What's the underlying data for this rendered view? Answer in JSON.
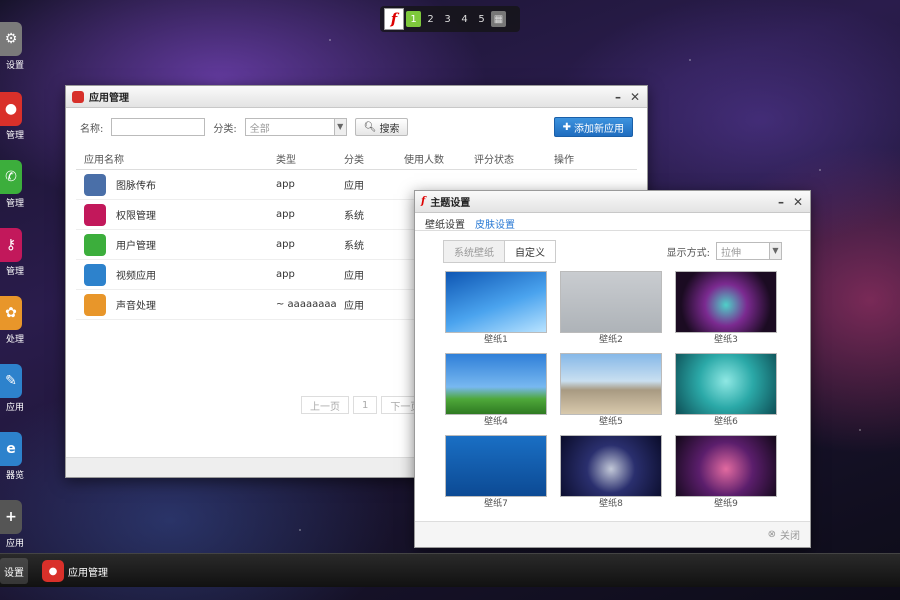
{
  "topbar": {
    "workspaces": [
      "1",
      "2",
      "3",
      "4",
      "5"
    ],
    "active_workspace": "1",
    "flash_glyph": "f"
  },
  "dock": {
    "items": [
      {
        "label": "设置",
        "color": "#7a7a7a"
      },
      {
        "label": "管理",
        "color": "#d9302a"
      },
      {
        "label": "管理",
        "color": "#3cae3c"
      },
      {
        "label": "管理",
        "color": "#c2185b"
      },
      {
        "label": "处理",
        "color": "#e8962a"
      },
      {
        "label": "应用",
        "color": "#2d82cc"
      },
      {
        "label": "器览",
        "color": "#2d82cc"
      },
      {
        "label": "应用",
        "color": "#555555"
      }
    ]
  },
  "taskbar": {
    "items": [
      {
        "label": "设置",
        "active": true
      },
      {
        "label": "应用管理",
        "active": false
      }
    ]
  },
  "app_manager": {
    "title": "应用管理",
    "filters": {
      "name_label": "名称:",
      "category_label": "分类:",
      "category_value": "全部",
      "search_button": "搜索",
      "add_button": "添加新应用"
    },
    "columns": [
      "应用名称",
      "类型",
      "分类",
      "使用人数",
      "评分状态",
      "操作"
    ],
    "rows": [
      {
        "name": "图脉传布",
        "type": "app",
        "category": "应用",
        "icon_color": "#4a6fa8"
      },
      {
        "name": "权限管理",
        "type": "app",
        "category": "系统",
        "icon_color": "#c2185b"
      },
      {
        "name": "用户管理",
        "type": "app",
        "category": "系统",
        "icon_color": "#3cae3c"
      },
      {
        "name": "视频应用",
        "type": "app",
        "category": "应用",
        "icon_color": "#2d82cc"
      },
      {
        "name": "声音处理",
        "type": "~ aaaaaaaa",
        "category": "应用",
        "icon_color": "#e8962a"
      }
    ],
    "pager": {
      "prev": "上一页",
      "page": "1",
      "next": "下一页"
    }
  },
  "theme_settings": {
    "title": "主题设置",
    "tabs": [
      "壁纸设置",
      "皮肤设置"
    ],
    "active_tab": "皮肤设置",
    "segment": [
      "系统壁纸",
      "自定义"
    ],
    "display_mode_label": "显示方式:",
    "display_mode_value": "拉伸",
    "wallpapers": [
      {
        "caption": "壁纸1",
        "bg": "linear-gradient(160deg,#0e56b3,#4aa3ee 55%,#b9e3ff)"
      },
      {
        "caption": "壁纸2",
        "bg": "linear-gradient(180deg,#c9ccd0,#aeb3b8)"
      },
      {
        "caption": "壁纸3",
        "bg": "radial-gradient(circle at 50% 55%,#4fd0c8 0%,#7b2a90 35%,#1b0b22 75%)"
      },
      {
        "caption": "壁纸4",
        "bg": "linear-gradient(180deg,#2f7fd8 0%,#78b8f0 55%,#4ea83a 75%,#2f7a22 100%)"
      },
      {
        "caption": "壁纸5",
        "bg": "linear-gradient(180deg,#86b8e8 0%,#c9dff0 45%,#a89a82 60%,#d8c9ac 100%)"
      },
      {
        "caption": "壁纸6",
        "bg": "radial-gradient(circle at 50% 45%,#8fe8e4 0%,#2ba9a8 45%,#0d4f56 100%)"
      },
      {
        "caption": "壁纸7",
        "bg": "linear-gradient(180deg,#1a6fc4,#0c4a94)"
      },
      {
        "caption": "壁纸8",
        "bg": "radial-gradient(circle at 50% 55%,#c2c8d8 0%,#2a2f6e 40%,#0a0c2a 100%)"
      },
      {
        "caption": "壁纸9",
        "bg": "radial-gradient(circle at 50% 55%,#e26aa0 0%,#5b1e6c 45%,#120818 100%)"
      }
    ],
    "footer_button": "关闭"
  }
}
